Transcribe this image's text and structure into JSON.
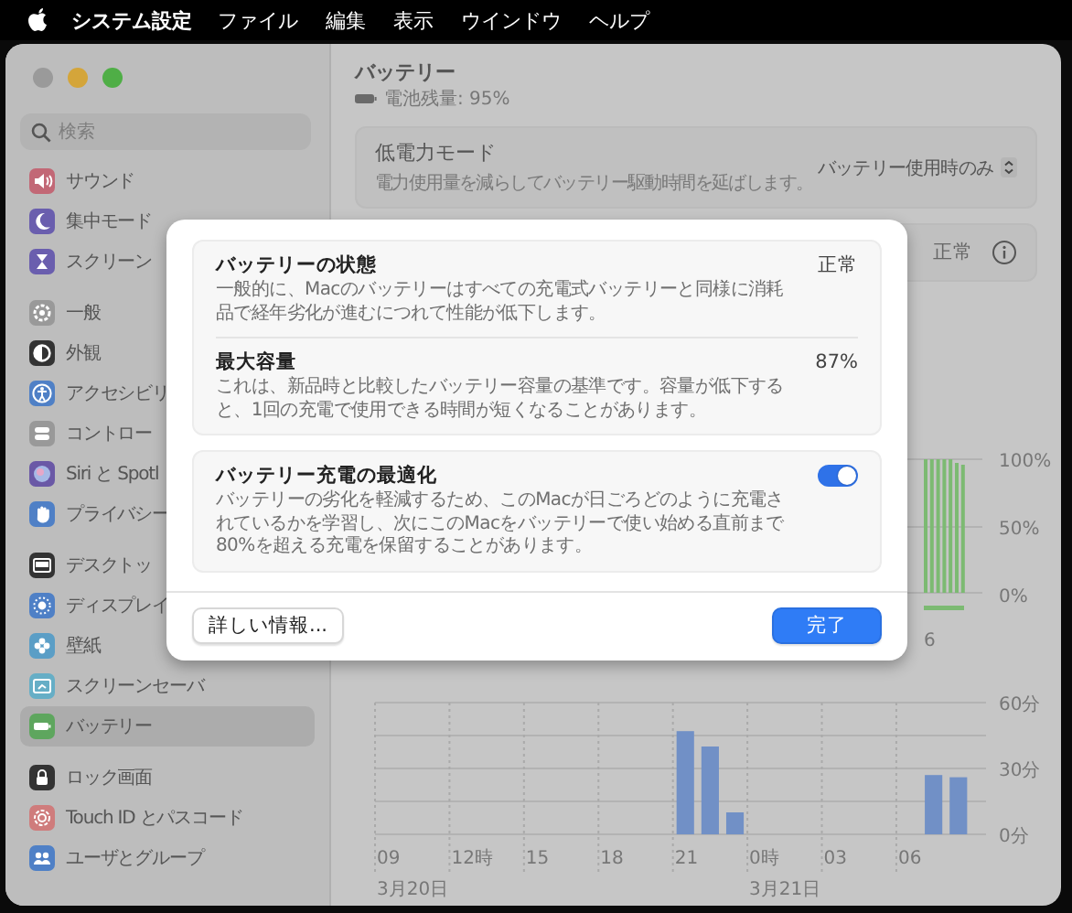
{
  "menu_bar": {
    "app_name": "システム設定",
    "menus": [
      "ファイル",
      "編集",
      "表示",
      "ウインドウ",
      "ヘルプ"
    ]
  },
  "sidebar": {
    "search": {
      "placeholder": "検索"
    },
    "groups": [
      [
        {
          "label": "サウンド",
          "selected": false
        },
        {
          "label": "集中モード",
          "selected": false
        },
        {
          "label": "スクリーン",
          "selected": false
        }
      ],
      [
        {
          "label": "一般",
          "selected": false
        },
        {
          "label": "外観",
          "selected": false
        },
        {
          "label": "アクセシビリ",
          "selected": false
        },
        {
          "label": "コントロー",
          "selected": false
        },
        {
          "label": "Siri と Spotl",
          "selected": false
        },
        {
          "label": "プライバシー",
          "selected": false
        }
      ],
      [
        {
          "label": "デスクトッ",
          "selected": false
        },
        {
          "label": "ディスプレイ",
          "selected": false
        },
        {
          "label": "壁紙",
          "selected": false
        },
        {
          "label": "スクリーンセーバ",
          "selected": false
        },
        {
          "label": "バッテリー",
          "selected": true
        }
      ],
      [
        {
          "label": "ロック画面",
          "selected": false
        },
        {
          "label": "Touch ID とパスコード",
          "selected": false
        },
        {
          "label": "ユーザとグループ",
          "selected": false
        }
      ]
    ]
  },
  "page": {
    "title": "バッテリー",
    "battery_status": "電池残量: 95%",
    "low_power": {
      "title": "低電力モード",
      "description": "電力使用量を減らしてバッテリー駆動時間を延ばします。",
      "value": "バッテリー使用時のみ"
    },
    "health_row": {
      "value": "正常"
    },
    "level_chart": {
      "y_labels": [
        "100%",
        "50%",
        "0%"
      ],
      "x_label": "6"
    },
    "usage_chart": {
      "y_labels": [
        "60分",
        "30分",
        "0分"
      ],
      "x_labels": [
        "09",
        "12時",
        "15",
        "18",
        "21",
        "0時",
        "03",
        "06"
      ],
      "date_labels": [
        "3月20日",
        "3月21日"
      ]
    }
  },
  "sheet": {
    "sections": [
      {
        "rows": [
          {
            "kind": "value",
            "title": "バッテリーの状態",
            "description": "一般的に、Macのバッテリーはすべての充電式バッテリーと同様に消耗品で経年劣化が進むにつれて性能が低下します。",
            "value": "正常"
          },
          {
            "kind": "value",
            "title": "最大容量",
            "description": "これは、新品時と比較したバッテリー容量の基準です。容量が低下すると、1回の充電で使用できる時間が短くなることがあります。",
            "value": "87%"
          }
        ]
      },
      {
        "rows": [
          {
            "kind": "toggle",
            "title": "バッテリー充電の最適化",
            "description": "バッテリーの劣化を軽減するため、このMacが日ごろどのように充電されているかを学習し、次にこのMacをバッテリーで使い始める直前まで80%を超える充電を保留することがあります。",
            "on": true
          }
        ]
      }
    ],
    "buttons": [
      {
        "kind": "secondary",
        "label": "詳しい情報..."
      },
      {
        "kind": "primary",
        "label": "完了"
      }
    ]
  }
}
